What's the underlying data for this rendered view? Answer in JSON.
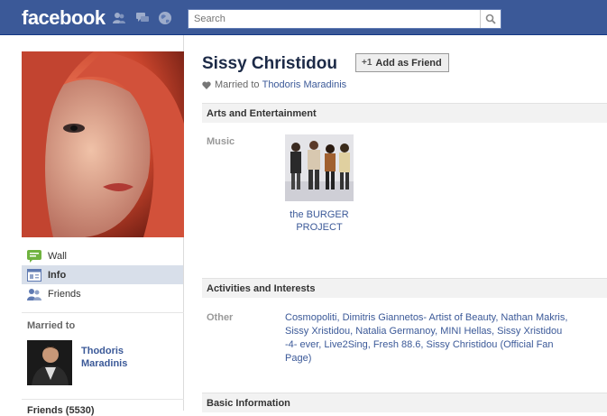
{
  "app": {
    "logo": "facebook"
  },
  "search": {
    "placeholder": "Search"
  },
  "profile": {
    "name": "Sissy Christidou",
    "add_friend": "Add as Friend",
    "add_friend_prefix": "+1",
    "relationship_prefix": "Married to",
    "relationship_person": "Thodoris Maradinis"
  },
  "nav": {
    "items": [
      {
        "label": "Wall",
        "icon": "wall-icon"
      },
      {
        "label": "Info",
        "icon": "info-icon",
        "active": true
      },
      {
        "label": "Friends",
        "icon": "friends-icon"
      }
    ]
  },
  "sidebar": {
    "married_heading": "Married to",
    "spouse_name": "Thodoris Maradinis",
    "friends_heading_cut": "Friends (5530)"
  },
  "sections": {
    "arts": {
      "title": "Arts and Entertainment",
      "music_label": "Music",
      "music_item": "the BURGER PROJECT"
    },
    "activities": {
      "title": "Activities and Interests",
      "other_label": "Other",
      "other_text": "Cosmopoliti, Dimitris Giannetos- Artist of Beauty, Nathan Makris, Sissy Xristidou, Natalia Germanoy, MINI Hellas, Sissy Xristidou -4- ever, Live2Sing, Fresh 88.6, Sissy Christidou (Official Fan Page)"
    },
    "basic": {
      "title": "Basic Information"
    }
  },
  "colors": {
    "topbar": "#3b5998",
    "link": "#3b5998",
    "name": "#1c2a47",
    "active_nav": "#d8dfea",
    "section_bg": "#f2f2f2"
  }
}
